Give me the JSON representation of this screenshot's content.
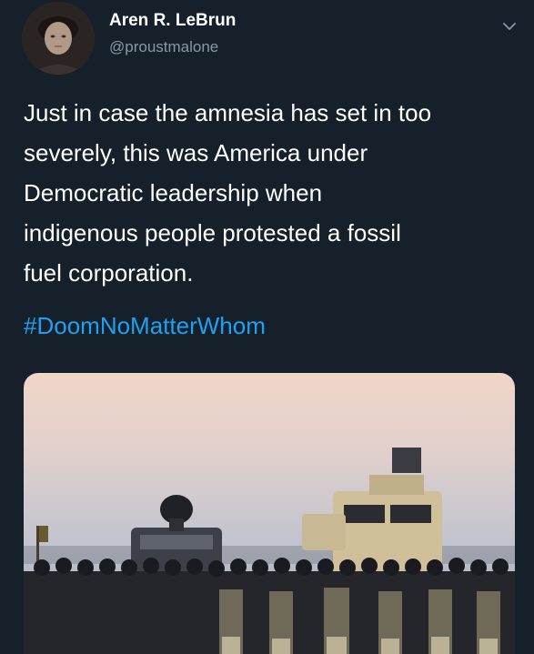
{
  "tweet": {
    "author": {
      "display_name": "Aren R. LeBrun",
      "handle": "@proustmalone"
    },
    "text": "Just in case the amnesia has set in too\nseverely, this was America under\nDemocratic leadership when\nindigenous people protested a fossil\nfuel corporation.",
    "hashtag": "#DoomNoMatterWhom"
  },
  "icons": {
    "menu": "chevron-down-icon"
  },
  "colors": {
    "background": "#15202b",
    "text": "#ffffff",
    "secondary_text": "#8899a6",
    "link": "#1da1f2"
  }
}
